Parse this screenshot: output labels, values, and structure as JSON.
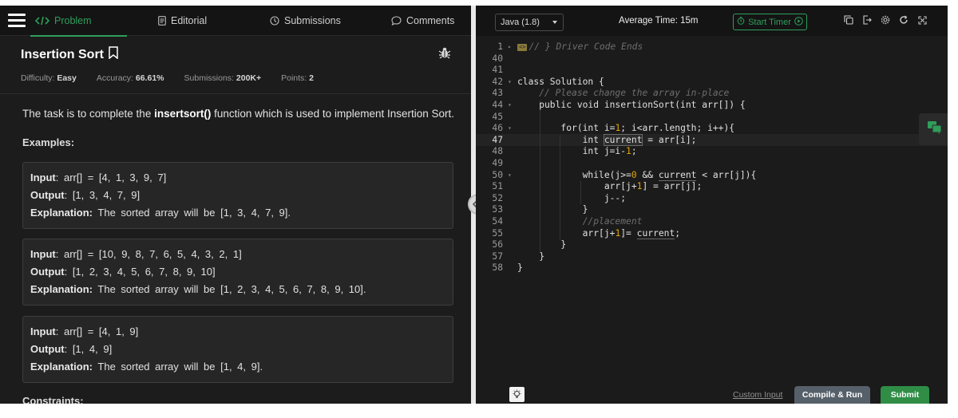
{
  "nav": {
    "tabs": [
      {
        "label": "Problem",
        "icon": "code-icon",
        "active": true
      },
      {
        "label": "Editorial",
        "icon": "document-icon"
      },
      {
        "label": "Submissions",
        "icon": "clock-icon"
      },
      {
        "label": "Comments",
        "icon": "comment-icon"
      }
    ]
  },
  "problem": {
    "title": "Insertion Sort",
    "meta": {
      "difficulty_label": "Difficulty:",
      "difficulty": "Easy",
      "accuracy_label": "Accuracy:",
      "accuracy": "66.61%",
      "submissions_label": "Submissions:",
      "submissions": "200K+",
      "points_label": "Points:",
      "points": "2"
    },
    "description_pre": "The task is to complete the ",
    "description_fn": "insertsort()",
    "description_post": " function which is used to implement Insertion Sort.",
    "examples_heading": "Examples:",
    "examples": [
      {
        "input_label": "Input",
        "input": ": arr[] = [4, 1, 3, 9, 7]",
        "output_label": "Output",
        "output": ": [1, 3, 4, 7, 9]",
        "explanation_label": "Explanation:",
        "explanation": " The sorted array will be [1, 3, 4, 7, 9]."
      },
      {
        "input_label": "Input",
        "input": ": arr[] = [10, 9, 8, 7, 6, 5, 4, 3, 2, 1]",
        "output_label": "Output",
        "output": ": [1, 2, 3, 4, 5, 6, 7, 8, 9, 10]",
        "explanation_label": "Explanation:",
        "explanation": " The sorted array will be [1, 2, 3, 4, 5, 6, 7, 8, 9, 10]."
      },
      {
        "input_label": "Input",
        "input": ": arr[] = [4, 1, 9]",
        "output_label": "Output",
        "output": ": [1, 4, 9]",
        "explanation_label": "Explanation:",
        "explanation": " The sorted array will be [1, 4, 9]."
      }
    ],
    "constraints_heading": "Constraints:"
  },
  "editor": {
    "language": "Java (1.8)",
    "avg_time": "Average Time: 15m",
    "timer_label": "Start Timer",
    "accent_color": "#2f9e5b",
    "line_numbers": [
      "1",
      "40",
      "41",
      "42",
      "43",
      "44",
      "45",
      "46",
      "47",
      "48",
      "49",
      "50",
      "51",
      "52",
      "53",
      "54",
      "55",
      "56",
      "57",
      "58"
    ],
    "current_line": "47"
  },
  "footer": {
    "custom_input": "Custom Input",
    "compile_run": "Compile & Run",
    "submit": "Submit"
  }
}
